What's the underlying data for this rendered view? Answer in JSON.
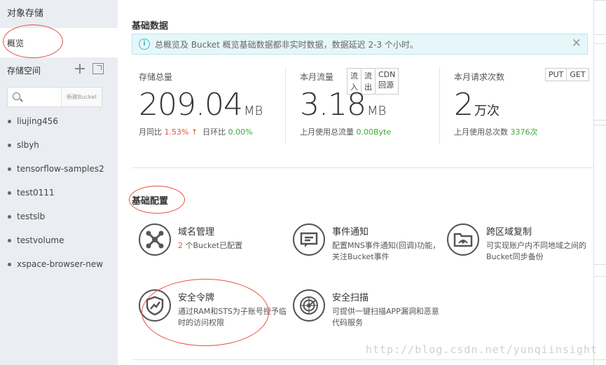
{
  "sidebar": {
    "title": "对象存储",
    "overview": "概览",
    "storage_space": "存储空间",
    "search_placeholder": "",
    "new_bucket": "新建Bucket",
    "buckets": [
      "liujing456",
      "slbyh",
      "tensorflow-samples2",
      "test0111",
      "testslb",
      "testvolume",
      "xspace-browser-new"
    ]
  },
  "basic_data": {
    "title": "基础数据",
    "notice": "总概览及 Bucket 概览基础数据都非实时数据，数据延迟 2-3 个小时。",
    "storage": {
      "label": "存储总量",
      "value": "209.04",
      "unit": "MB",
      "mom_label": "月同比",
      "mom_value": "1.53%",
      "dod_label": "日环比",
      "dod_value": "0.00%"
    },
    "traffic": {
      "label": "本月流量",
      "tabs": [
        "流入",
        "流出",
        "CDN回源"
      ],
      "value": "3.18",
      "unit": "MB",
      "sub_label": "上月使用总流量",
      "sub_value": "0.00Byte"
    },
    "requests": {
      "label": "本月请求次数",
      "tabs": [
        "PUT",
        "GET"
      ],
      "value": "2",
      "unit": "万次",
      "sub_label": "上月使用总次数",
      "sub_value": "3376次"
    }
  },
  "basic_config": {
    "title": "基础配置",
    "cards": [
      {
        "title": "域名管理",
        "desc_count": "2",
        "desc": " 个Bucket已配置"
      },
      {
        "title": "事件通知",
        "desc": "配置MNS事件通知(回调)功能，关注Bucket事件"
      },
      {
        "title": "跨区域复制",
        "desc": "可实现账户内不同地域之间的Bucket同步备份"
      },
      {
        "title": "安全令牌",
        "desc": "通过RAM和STS为子账号授予临时的访问权限"
      },
      {
        "title": "安全扫描",
        "desc": "可提供一键扫描APP漏洞和恶意代码服务"
      }
    ]
  },
  "watermark": "http://blog.csdn.net/yunqiinsight"
}
